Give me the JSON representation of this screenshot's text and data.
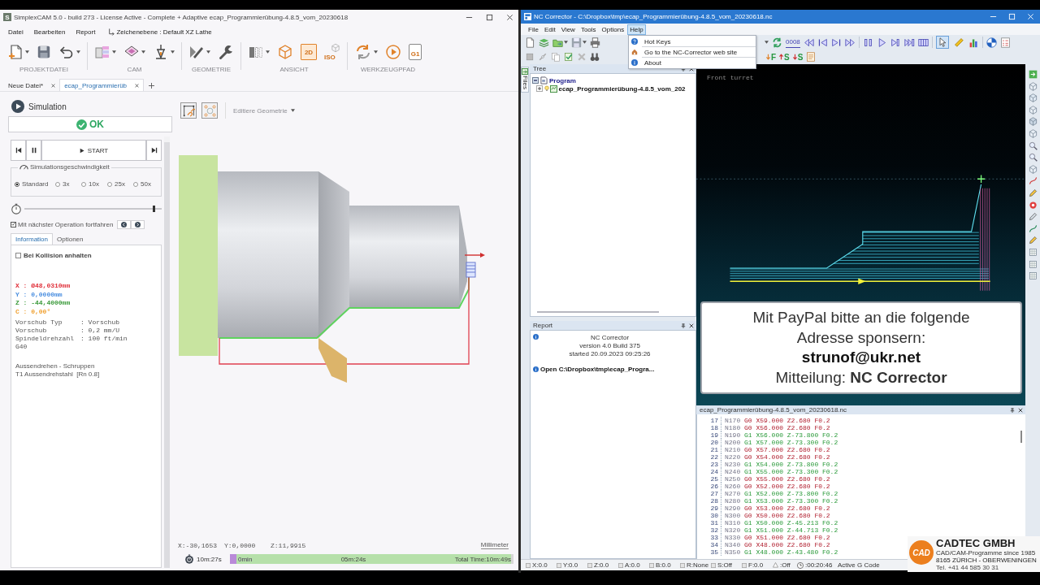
{
  "simplexcam": {
    "app_icon": "S",
    "title": "SimplexCAM 5.0 - build 273 - License Active -  Complete + Adaptive ecap_Programmierübung-4.8.5_vom_20230618",
    "menu": [
      {
        "label": "Datei"
      },
      {
        "label": "Bearbeiten"
      },
      {
        "label": "Report"
      }
    ],
    "drawing_plane": "Zeichenebene : Default XZ Lathe",
    "ribbon": [
      {
        "label": "PROJEKTDATEI"
      },
      {
        "label": "CAM"
      },
      {
        "label": "GEOMETRIE"
      },
      {
        "label": "ANSICHT",
        "icon_texts": [
          "2D",
          "ISO"
        ]
      },
      {
        "label": "WERKZEUGPFAD",
        "icon_texts": [
          "G1"
        ]
      }
    ],
    "doc_tabs": [
      {
        "label": "Neue Datei*",
        "selected": false
      },
      {
        "label": "ecap_Programmierüb",
        "selected": true
      }
    ],
    "simulation": {
      "title": "Simulation",
      "status": "OK",
      "start_label": "START",
      "speed_title": "Simulationsgeschwindigkeit",
      "speeds": [
        {
          "label": "Standard",
          "selected": true
        },
        {
          "label": "3x",
          "selected": false
        },
        {
          "label": "10x",
          "selected": false
        },
        {
          "label": "25x",
          "selected": false
        },
        {
          "label": "50x",
          "selected": false
        }
      ],
      "position": {
        "level": 0.94
      },
      "continue": {
        "label": "Mit nächster Operation fortfahren",
        "checked": true
      },
      "tabs": [
        {
          "label": "Information",
          "selected": true
        },
        {
          "label": "Optionen",
          "selected": false
        }
      ],
      "stop_on_collision": {
        "label": "Bei Kollision anhalten",
        "checked": false
      },
      "axes": [
        {
          "text": "X : Ø48,0310mm",
          "color": "#e0303a"
        },
        {
          "text": "Y : 0,0000mm",
          "color": "#4a8ee0"
        },
        {
          "text": "Z : -44,4000mm",
          "color": "#3a9a3a"
        },
        {
          "text": "C : 0,00°",
          "color": "#f0a030"
        }
      ],
      "params": [
        {
          "name": "Vorschub Typ",
          "value": ": Vorschub"
        },
        {
          "name": "Vorschub",
          "value": ": 0,2 mm/U"
        },
        {
          "name": "Spindeldrehzahl",
          "value": ": 100 ft/min"
        }
      ],
      "compensation": "G40",
      "operation": "Aussendrehen - Schruppen",
      "tool": "T1 Aussendrehstahl  [Rn 0.8]"
    },
    "viewport": {
      "geometry_dropdown": {
        "label": "Editiere Geometrie",
        "disabled": true
      },
      "coordinates": [
        "X:-30,1653",
        "Y:0,0000",
        "Z:11,9915"
      ],
      "unit": "Millimeter",
      "timeline": {
        "elapsed": "10m:27s",
        "start": "0min",
        "middle": "05m:24s",
        "total": "Total Time:10m:49s",
        "level": 0.99
      }
    }
  },
  "nc_corrector": {
    "title": "NC Corrector - C:\\Dropbox\\tmp\\ecap_Programmierübung-4.8.5_vom_20230618.nc",
    "menu": [
      {
        "label": "File",
        "selected": false
      },
      {
        "label": "Edit",
        "selected": false
      },
      {
        "label": "View",
        "selected": false
      },
      {
        "label": "Tools",
        "selected": false
      },
      {
        "label": "Options",
        "selected": false
      },
      {
        "label": "Help",
        "selected": true
      }
    ],
    "help_menu": [
      {
        "label": "Hot Keys"
      },
      {
        "label": "Go to the NC-Corrector web site"
      },
      {
        "label": "About"
      }
    ],
    "counter": "0008",
    "mode_tools": [
      {
        "selected": true
      },
      {
        "selected": false
      }
    ],
    "filters": [
      {
        "label": "F"
      },
      {
        "label": "S"
      },
      {
        "label": "S"
      }
    ],
    "files_tab": "Files",
    "tree": {
      "title": "Tree",
      "items": [
        {
          "label": "Program",
          "expanded": true,
          "children": [
            {
              "label": "ecap_Programmierübung-4.8.5_vom_202",
              "expanded": false
            }
          ]
        }
      ]
    },
    "report": {
      "title": "Report",
      "entries": [
        {
          "kind": "info",
          "lines": [
            "NC Corrector",
            "version 4.0 Build 375",
            "started 20.09.2023 09:25:26"
          ]
        },
        {
          "kind": "action",
          "lines": [
            "Open C:\\Dropbox\\tmp\\ecap_Progra..."
          ]
        }
      ]
    },
    "viewport": {
      "label": "Front turret",
      "sponsor": {
        "request": "Mit PayPal bitte an die folgende Adresse sponsern:",
        "email": "strunof@ukr.net",
        "message": "Mitteilung: **NC Corrector**"
      }
    },
    "code": {
      "title": "ecap_Programmierübung-4.8.5_vom_20230618.nc",
      "lines": [
        {
          "number": "17",
          "block": "N170",
          "code": "G0 X59.000 Z2.680 F0.2",
          "kind": "rapid"
        },
        {
          "number": "18",
          "block": "N180",
          "code": "G0 X56.000 Z2.680 F0.2",
          "kind": "rapid"
        },
        {
          "number": "19",
          "block": "N190",
          "code": "G1 X56.000 Z-73.800 F0.2",
          "kind": "feed"
        },
        {
          "number": "20",
          "block": "N200",
          "code": "G1 X57.000 Z-73.300 F0.2",
          "kind": "feed"
        },
        {
          "number": "21",
          "block": "N210",
          "code": "G0 X57.000 Z2.680 F0.2",
          "kind": "rapid"
        },
        {
          "number": "22",
          "block": "N220",
          "code": "G0 X54.000 Z2.680 F0.2",
          "kind": "rapid"
        },
        {
          "number": "23",
          "block": "N230",
          "code": "G1 X54.000 Z-73.800 F0.2",
          "kind": "feed"
        },
        {
          "number": "24",
          "block": "N240",
          "code": "G1 X55.000 Z-73.300 F0.2",
          "kind": "feed"
        },
        {
          "number": "25",
          "block": "N250",
          "code": "G0 X55.000 Z2.680 F0.2",
          "kind": "rapid"
        },
        {
          "number": "26",
          "block": "N260",
          "code": "G0 X52.000 Z2.680 F0.2",
          "kind": "rapid"
        },
        {
          "number": "27",
          "block": "N270",
          "code": "G1 X52.000 Z-73.800 F0.2",
          "kind": "feed"
        },
        {
          "number": "28",
          "block": "N280",
          "code": "G1 X53.000 Z-73.300 F0.2",
          "kind": "feed"
        },
        {
          "number": "29",
          "block": "N290",
          "code": "G0 X53.000 Z2.680 F0.2",
          "kind": "rapid"
        },
        {
          "number": "30",
          "block": "N300",
          "code": "G0 X50.000 Z2.680 F0.2",
          "kind": "rapid"
        },
        {
          "number": "31",
          "block": "N310",
          "code": "G1 X50.000 Z-45.213 F0.2",
          "kind": "feed"
        },
        {
          "number": "32",
          "block": "N320",
          "code": "G1 X51.000 Z-44.713 F0.2",
          "kind": "feed"
        },
        {
          "number": "33",
          "block": "N330",
          "code": "G0 X51.000 Z2.680 F0.2",
          "kind": "rapid"
        },
        {
          "number": "34",
          "block": "N340",
          "code": "G0 X48.000 Z2.680 F0.2",
          "kind": "rapid"
        },
        {
          "number": "35",
          "block": "N350",
          "code": "G1 X48.000 Z-43.480 F0.2",
          "kind": "feed"
        }
      ]
    },
    "status_bar": [
      {
        "kind": "value",
        "text": "X:0.0"
      },
      {
        "kind": "value",
        "text": "Y:0.0"
      },
      {
        "kind": "value",
        "text": "Z:0.0"
      },
      {
        "kind": "value",
        "text": "A:0.0"
      },
      {
        "kind": "value",
        "text": "B:0.0"
      },
      {
        "kind": "value",
        "text": "R:None"
      },
      {
        "kind": "value",
        "text": "S:Off"
      },
      {
        "kind": "value",
        "text": "F:0.0"
      },
      {
        "kind": "warning",
        "text": ":Off"
      },
      {
        "kind": "time",
        "text": ":00:20:46"
      },
      {
        "kind": "text",
        "text": "Active G Code"
      }
    ]
  },
  "overlay_logo": {
    "emblem": "CAD",
    "name": "CADTEC GMBH",
    "tagline": "CAD/CAM-Programme since 1985",
    "address": "8165 ZÜRICH - OBERWENINGEN",
    "phone": "Tel.  +41 44 585 30 31"
  }
}
